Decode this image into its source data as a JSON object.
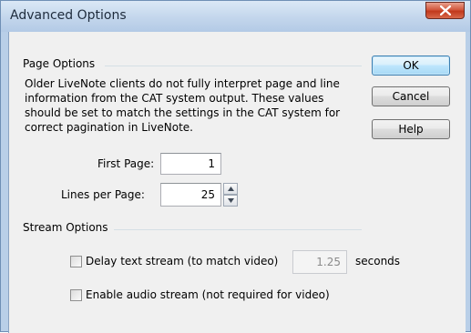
{
  "window": {
    "title": "Advanced Options",
    "close_symbol": "X"
  },
  "page_options": {
    "group_label": "Page Options",
    "description": "Older LiveNote clients do not fully interpret page and line information from the CAT system output.  These values should be set to match the settings in the CAT system for correct pagination in LiveNote.",
    "first_page_label": "First Page:",
    "first_page_value": "1",
    "lines_per_page_label": "Lines per Page:",
    "lines_per_page_value": "25"
  },
  "stream_options": {
    "group_label": "Stream Options",
    "delay_label": "Delay text stream (to match video)",
    "delay_checked": false,
    "delay_value": "1.25",
    "delay_unit": "seconds",
    "audio_label": "Enable audio stream (not required for video)",
    "audio_checked": false
  },
  "buttons": {
    "ok": "OK",
    "cancel": "Cancel",
    "help": "Help"
  },
  "colors": {
    "titlebar": "#c3d6ec",
    "close_button": "#c1391c",
    "dialog_background": "#f0f0f0",
    "default_button": "#bee6fd"
  },
  "icons": {
    "close": "close-icon",
    "spin_up": "spin-up-icon",
    "spin_down": "spin-down-icon"
  }
}
